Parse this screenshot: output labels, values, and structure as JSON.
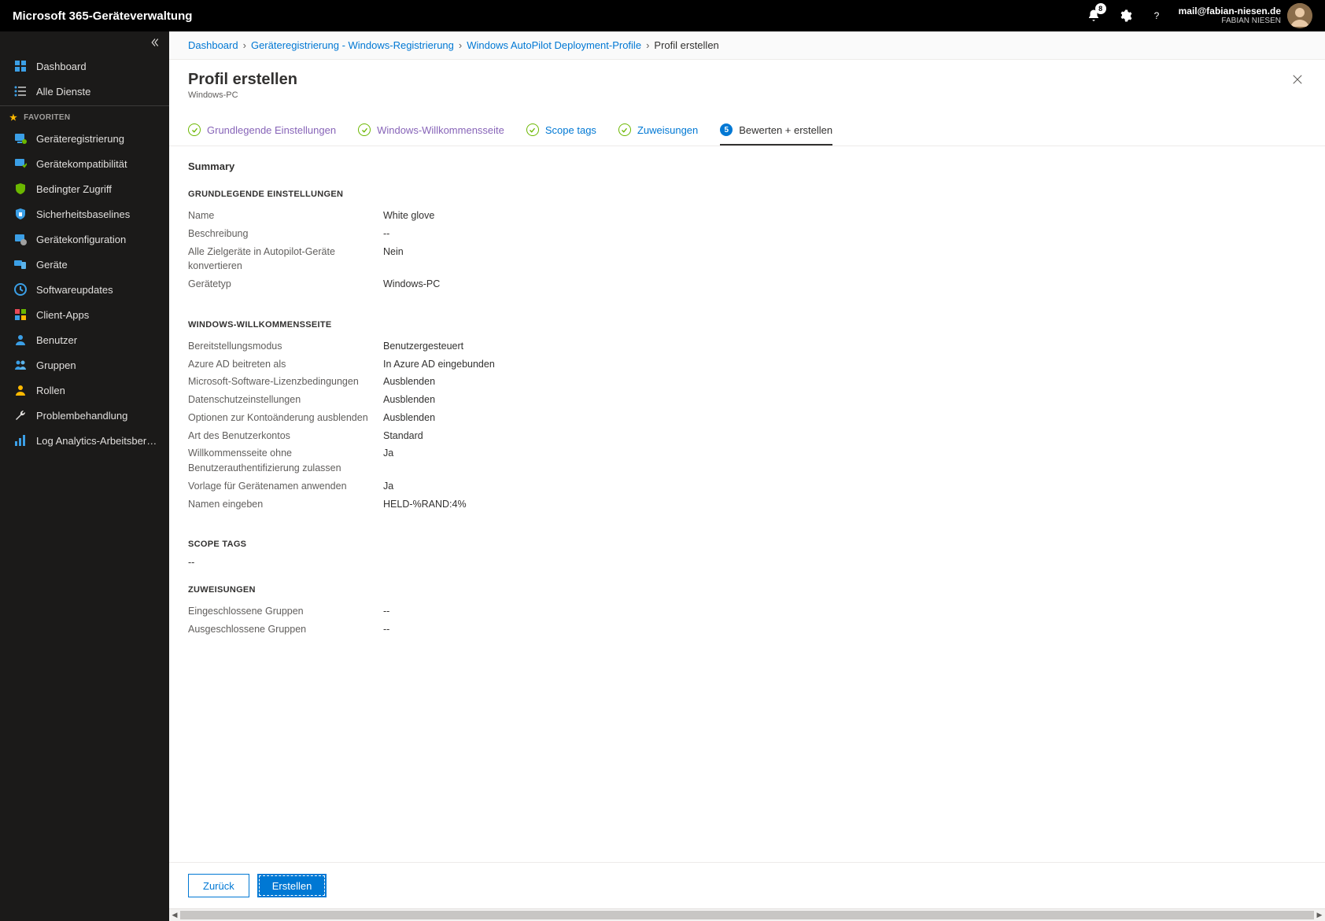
{
  "topbar": {
    "brand": "Microsoft 365-Geräteverwaltung",
    "notification_count": "8",
    "user_email": "mail@fabian-niesen.de",
    "user_name": "FABIAN NIESEN"
  },
  "sidebar": {
    "dashboard": "Dashboard",
    "all_services": "Alle Dienste",
    "favorites_header": "FAVORITEN",
    "items": [
      "Geräteregistrierung",
      "Gerätekompatibilität",
      "Bedingter Zugriff",
      "Sicherheitsbaselines",
      "Gerätekonfiguration",
      "Geräte",
      "Softwareupdates",
      "Client-Apps",
      "Benutzer",
      "Gruppen",
      "Rollen",
      "Problembehandlung",
      "Log Analytics-Arbeitsbereic..."
    ]
  },
  "breadcrumb": {
    "items": [
      "Dashboard",
      "Geräteregistrierung - Windows-Registrierung",
      "Windows AutoPilot Deployment-Profile"
    ],
    "current": "Profil erstellen"
  },
  "blade": {
    "title": "Profil erstellen",
    "subtitle": "Windows-PC"
  },
  "tabs": {
    "t0": "Grundlegende Einstellungen",
    "t1": "Windows-Willkommensseite",
    "t2": "Scope tags",
    "t3": "Zuweisungen",
    "t4_num": "5",
    "t4": "Bewerten + erstellen"
  },
  "summary": {
    "heading": "Summary",
    "section1": "GRUNDLEGENDE EINSTELLUNGEN",
    "s1": [
      {
        "k": "Name",
        "v": "White glove"
      },
      {
        "k": "Beschreibung",
        "v": "--"
      },
      {
        "k": "Alle Zielgeräte in Autopilot-Geräte konvertieren",
        "v": "Nein"
      },
      {
        "k": "Gerätetyp",
        "v": "Windows-PC"
      }
    ],
    "section2": "WINDOWS-WILLKOMMENSSEITE",
    "s2": [
      {
        "k": "Bereitstellungsmodus",
        "v": "Benutzergesteuert"
      },
      {
        "k": "Azure AD beitreten als",
        "v": "In Azure AD eingebunden"
      },
      {
        "k": "Microsoft-Software-Lizenzbedingungen",
        "v": "Ausblenden"
      },
      {
        "k": "Datenschutzeinstellungen",
        "v": "Ausblenden"
      },
      {
        "k": "Optionen zur Kontoänderung ausblenden",
        "v": "Ausblenden"
      },
      {
        "k": "Art des Benutzerkontos",
        "v": "Standard"
      },
      {
        "k": "Willkommensseite ohne Benutzerauthentifizierung zulassen",
        "v": "Ja"
      },
      {
        "k": "Vorlage für Gerätenamen anwenden",
        "v": "Ja"
      },
      {
        "k": "Namen eingeben",
        "v": "HELD-%RAND:4%"
      }
    ],
    "section3": "SCOPE TAGS",
    "scope_value": "--",
    "section4": "ZUWEISUNGEN",
    "s4": [
      {
        "k": "Eingeschlossene Gruppen",
        "v": "--"
      },
      {
        "k": "Ausgeschlossene Gruppen",
        "v": "--"
      }
    ]
  },
  "footer": {
    "back": "Zurück",
    "create": "Erstellen"
  }
}
